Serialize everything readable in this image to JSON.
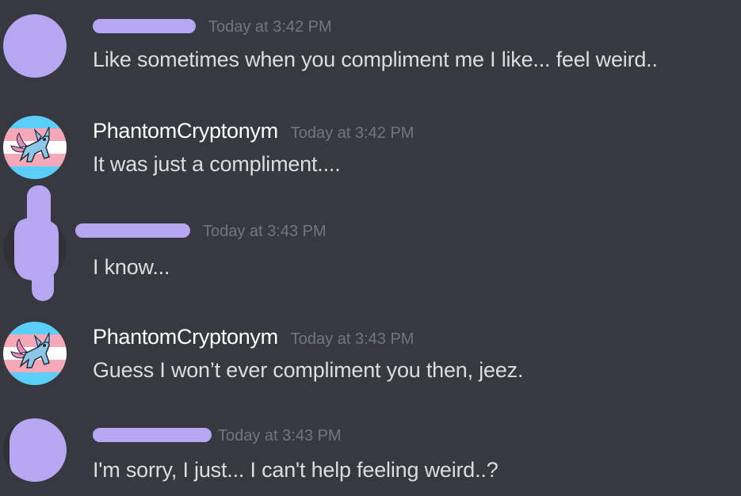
{
  "messages": [
    {
      "author": "",
      "author_hidden": true,
      "timestamp": "Today at 3:42 PM",
      "text": "Like sometimes when you compliment me I like... feel weird.."
    },
    {
      "author": "PhantomCryptonym",
      "author_hidden": false,
      "timestamp": "Today at 3:42 PM",
      "text": "It was just a compliment...."
    },
    {
      "author": "",
      "author_hidden": true,
      "timestamp": "Today at 3:43 PM",
      "text": "I know..."
    },
    {
      "author": "PhantomCryptonym",
      "author_hidden": false,
      "timestamp": "Today at 3:43 PM",
      "text": "Guess I won’t ever compliment you then, jeez."
    },
    {
      "author": "",
      "author_hidden": true,
      "timestamp": "Today at 3:43 PM",
      "text": "I'm sorry, I just... I can't help feeling weird..?"
    }
  ],
  "colors": {
    "background": "#36393f",
    "username": "#ffffff",
    "timestamp": "#72767d",
    "message_text": "#dcddde",
    "redaction": "#b7a7f2",
    "trans_blue": "#5bcefa",
    "trans_pink": "#f5a9b8"
  },
  "icons": {
    "phantom_avatar": "pokemon-on-trans-flag-avatar",
    "hidden_avatar": "scribbled-out-avatar"
  }
}
